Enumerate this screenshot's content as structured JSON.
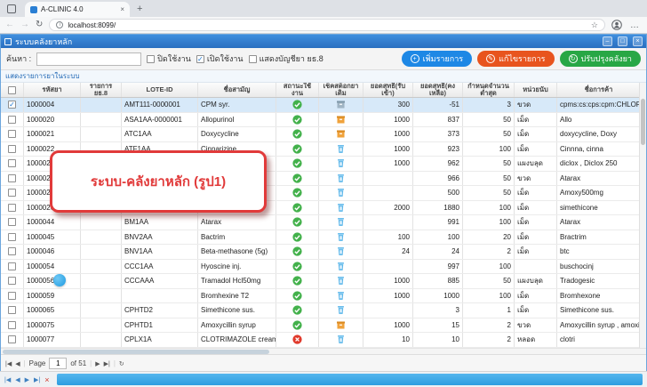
{
  "browser": {
    "tab_title": "A-CLINIC 4.0",
    "url": "localhost:8099/"
  },
  "icons": {
    "back": "←",
    "forward": "→",
    "refresh": "↻",
    "star": "☆",
    "menu": "…",
    "new_tab": "+",
    "tab_close": "×",
    "info": "i",
    "win_min": "–",
    "win_max": "□",
    "win_close": "×",
    "btn_add": "+",
    "btn_edit": "✎",
    "btn_update": "↻",
    "check": "✓",
    "pager_first": "|◀",
    "pager_prev": "◀",
    "pager_next": "▶",
    "pager_last": "▶|",
    "pager_refresh": "↻",
    "bottom_first": "|◀",
    "bottom_prev": "◀",
    "bottom_next": "▶",
    "bottom_last": "▶|",
    "bottom_close": "×"
  },
  "window": {
    "title": "ระบบคลังยาหลัก"
  },
  "toolbar": {
    "search_label": "ค้นหา :",
    "search_value": "",
    "checkbox_disabled": "ปิดใช้งาน",
    "checkbox_enabled": "เปิดใช้งาน",
    "checkbox_show_account": "แสดงบัญชียา ยธ.8",
    "add_button": "เพิ่มรายการ",
    "edit_button": "แก้ไขรายการ",
    "update_button": "ปรับปรุงคลังยา"
  },
  "grid": {
    "caption": "แสดงรายการยาในระบบ",
    "columns": [
      "รหัสยา",
      "รายการ ยธ.8",
      "LOTE-ID",
      "ชื่อสามัญ",
      "สถานะใช้งาน",
      "เช็คสต็อกยาเดิม",
      "ยอดสุทธิ(รับเข้า)",
      "ยอดสุทธิ(คงเหลือ)",
      "กำหนดจำนวนต่ำสุด",
      "หน่วยนับ",
      "ชื่อการค้า"
    ],
    "rows": [
      {
        "checked": true,
        "selected": true,
        "code": "1000004",
        "list8": "",
        "lote": "AMT111-0000001",
        "name": "CPM syr.",
        "status": "active",
        "stock": "box-gray",
        "received": "300",
        "remaining": "-51",
        "min": "3",
        "unit": "ขวด",
        "trade": "cpms:cs:cps:cpm:CHLORPHENIRAMI"
      },
      {
        "checked": false,
        "selected": false,
        "code": "1000020",
        "list8": "",
        "lote": "ASA1AA-0000001",
        "name": "Allopurinol",
        "status": "active",
        "stock": "box-orange",
        "received": "1000",
        "remaining": "837",
        "min": "50",
        "unit": "เม็ด",
        "trade": "Allo"
      },
      {
        "checked": false,
        "selected": false,
        "code": "1000021",
        "list8": "",
        "lote": "ATC1AA",
        "name": "Doxycycline",
        "status": "active",
        "stock": "box-orange",
        "received": "1000",
        "remaining": "373",
        "min": "50",
        "unit": "เม็ด",
        "trade": "doxycycline, Doxy"
      },
      {
        "checked": false,
        "selected": false,
        "code": "1000022",
        "list8": "",
        "lote": "ATF1AA",
        "name": "Cinnarizine",
        "status": "active",
        "stock": "bucket-blue",
        "received": "1000",
        "remaining": "923",
        "min": "100",
        "unit": "เม็ด",
        "trade": "Cinnna, cinna"
      },
      {
        "checked": false,
        "selected": false,
        "code": "1000023",
        "list8": "",
        "lote": "",
        "name": "",
        "status": "active",
        "stock": "bucket-blue",
        "received": "1000",
        "remaining": "962",
        "min": "50",
        "unit": "แผงบลุด",
        "trade": "diclox , Diclox 250"
      },
      {
        "checked": false,
        "selected": false,
        "code": "1000024",
        "list8": "",
        "lote": "",
        "name": "",
        "status": "active",
        "stock": "bucket-blue",
        "received": "",
        "remaining": "966",
        "min": "50",
        "unit": "ขวด",
        "trade": "Atarax"
      },
      {
        "checked": false,
        "selected": false,
        "code": "1000025",
        "list8": "",
        "lote": "",
        "name": "",
        "status": "active",
        "stock": "bucket-blue",
        "received": "",
        "remaining": "500",
        "min": "50",
        "unit": "เม็ด",
        "trade": "Amoxy500mg"
      },
      {
        "checked": false,
        "selected": false,
        "code": "1000026",
        "list8": "",
        "lote": "",
        "name": "",
        "status": "active",
        "stock": "bucket-blue",
        "received": "2000",
        "remaining": "1880",
        "min": "100",
        "unit": "เม็ด",
        "trade": "simethicone"
      },
      {
        "checked": false,
        "selected": false,
        "code": "1000044",
        "list8": "",
        "lote": "BM1AA",
        "name": "Atarax",
        "status": "active",
        "stock": "bucket-blue",
        "received": "",
        "remaining": "991",
        "min": "100",
        "unit": "เม็ด",
        "trade": "Atarax"
      },
      {
        "checked": false,
        "selected": false,
        "code": "1000045",
        "list8": "",
        "lote": "BNV2AA",
        "name": "Bactrim",
        "status": "active",
        "stock": "bucket-blue",
        "received": "100",
        "remaining": "100",
        "min": "20",
        "unit": "เม็ด",
        "trade": "Bractrim"
      },
      {
        "checked": false,
        "selected": false,
        "code": "1000046",
        "list8": "",
        "lote": "BNV1AA",
        "name": "Beta-methasone (5g)",
        "status": "active",
        "stock": "bucket-blue",
        "received": "24",
        "remaining": "24",
        "min": "2",
        "unit": "เม็ด",
        "trade": "btc"
      },
      {
        "checked": false,
        "selected": false,
        "code": "1000054",
        "list8": "",
        "lote": "CCC1AA",
        "name": "Hyoscine inj.",
        "status": "active",
        "stock": "bucket-blue",
        "received": "",
        "remaining": "997",
        "min": "100",
        "unit": "",
        "trade": "buschocinj"
      },
      {
        "checked": false,
        "selected": false,
        "code": "1000056",
        "list8": "",
        "lote": "CCCAAA",
        "name": "Tramadol Hcl50mg",
        "status": "active",
        "stock": "bucket-blue",
        "received": "1000",
        "remaining": "885",
        "min": "50",
        "unit": "แผงบลุด",
        "trade": "Tradogesic"
      },
      {
        "checked": false,
        "selected": false,
        "code": "1000059",
        "list8": "",
        "lote": "",
        "name": "Bromhexine T2",
        "status": "active",
        "stock": "bucket-blue",
        "received": "1000",
        "remaining": "1000",
        "min": "100",
        "unit": "เม็ด",
        "trade": "Bromhexone"
      },
      {
        "checked": false,
        "selected": false,
        "code": "1000065",
        "list8": "",
        "lote": "CPHTD2",
        "name": "Simethicone sus.",
        "status": "active",
        "stock": "bucket-blue",
        "received": "",
        "remaining": "3",
        "min": "1",
        "unit": "เม็ด",
        "trade": "Simethicone sus."
      },
      {
        "checked": false,
        "selected": false,
        "code": "1000075",
        "list8": "",
        "lote": "CPHTD1",
        "name": "Amoxycillin syrup",
        "status": "active",
        "stock": "box-orange",
        "received": "1000",
        "remaining": "15",
        "min": "2",
        "unit": "ขวด",
        "trade": "Amoxycillin syrup , amoxi syr, amoxy"
      },
      {
        "checked": false,
        "selected": false,
        "code": "1000077",
        "list8": "",
        "lote": "CPLX1A",
        "name": "CLOTRIMAZOLE cream",
        "status": "inactive",
        "stock": "bucket-blue",
        "received": "10",
        "remaining": "10",
        "min": "2",
        "unit": "หลอด",
        "trade": "clotri"
      }
    ]
  },
  "pagination": {
    "page_label": "Page",
    "page_value": "1",
    "of_label": "of 51"
  },
  "annotation": {
    "text": "ระบบ-คลังยาหลัก  (รูป1)"
  },
  "colors": {
    "accent_blue": "#1e88e5",
    "accent_orange": "#e8541e",
    "accent_green": "#28a745",
    "status_ok": "#43b14b",
    "status_bad": "#e0392b",
    "annotation_red": "#e13a3a"
  }
}
